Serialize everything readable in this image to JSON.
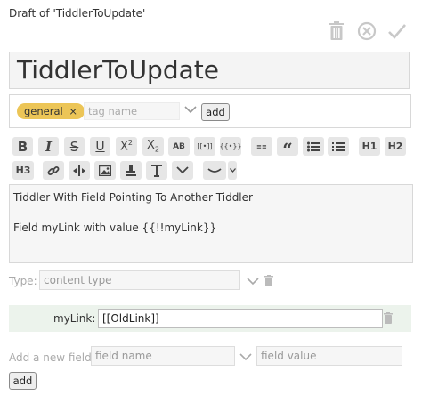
{
  "header": {
    "draft_title": "Draft of 'TiddlerToUpdate'"
  },
  "icons": {
    "delete": "trash-icon",
    "cancel": "cancel-icon",
    "save": "checkmark-icon"
  },
  "title": {
    "value": "TiddlerToUpdate"
  },
  "tags": {
    "items": [
      {
        "label": "general",
        "remove": "×"
      }
    ],
    "input_placeholder": "tag name",
    "add_label": "add",
    "tag_color": "#ecc557"
  },
  "toolbar": {
    "strikethrough": "S",
    "underline": "U",
    "superscript": "X",
    "superscript_mark": "2",
    "subscript": "X",
    "subscript_mark": "2",
    "smallcaps": "AB",
    "transclude": "[[•]]",
    "macro": "{{•}}",
    "excise": "≡≡",
    "heading1": "H1",
    "heading2": "H2",
    "heading3": "H3"
  },
  "body": {
    "line1": "Tiddler With Field Pointing To Another Tiddler",
    "line2": "Field myLink with value {{!!myLink}}"
  },
  "type": {
    "label": "Type:",
    "placeholder": "content type"
  },
  "fields": [
    {
      "name": "myLink:",
      "value": "[[OldLink]]"
    }
  ],
  "new_field": {
    "label": "Add a new field:",
    "name_placeholder": "field name",
    "value_placeholder": "field value",
    "add_label": "add"
  },
  "colors": {
    "field_row_bg": "#ecf3ec",
    "toolbar_button_bg": "#e6e6e6",
    "icon_grey": "#c8c8c8"
  }
}
